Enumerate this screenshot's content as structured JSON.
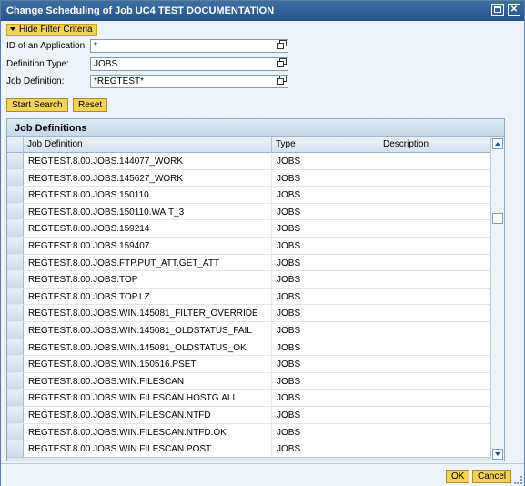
{
  "window": {
    "title": "Change Scheduling of Job UC4 TEST DOCUMENTATION"
  },
  "filter": {
    "toggle_label": "Hide Filter Criteria",
    "fields": [
      {
        "label": "ID of an Application:",
        "value": "*"
      },
      {
        "label": "Definition Type:",
        "value": "JOBS"
      },
      {
        "label": "Job Definition:",
        "value": "*REGTEST*"
      }
    ],
    "start_search_label": "Start Search",
    "reset_label": "Reset"
  },
  "table": {
    "title": "Job Definitions",
    "columns": [
      "Job Definition",
      "Type",
      "Description"
    ],
    "rows": [
      {
        "job": "REGTEST.8.00.JOBS.144077_WORK",
        "type": "JOBS",
        "desc": ""
      },
      {
        "job": "REGTEST.8.00.JOBS.145627_WORK",
        "type": "JOBS",
        "desc": ""
      },
      {
        "job": "REGTEST.8.00.JOBS.150110",
        "type": "JOBS",
        "desc": ""
      },
      {
        "job": "REGTEST.8.00.JOBS.150110.WAIT_3",
        "type": "JOBS",
        "desc": ""
      },
      {
        "job": "REGTEST.8.00.JOBS.159214",
        "type": "JOBS",
        "desc": ""
      },
      {
        "job": "REGTEST.8.00.JOBS.159407",
        "type": "JOBS",
        "desc": ""
      },
      {
        "job": "REGTEST.8.00.JOBS.FTP.PUT_ATT.GET_ATT",
        "type": "JOBS",
        "desc": ""
      },
      {
        "job": "REGTEST.8.00.JOBS.TOP",
        "type": "JOBS",
        "desc": ""
      },
      {
        "job": "REGTEST.8.00.JOBS.TOP.LZ",
        "type": "JOBS",
        "desc": ""
      },
      {
        "job": "REGTEST.8.00.JOBS.WIN.145081_FILTER_OVERRIDE",
        "type": "JOBS",
        "desc": ""
      },
      {
        "job": "REGTEST.8.00.JOBS.WIN.145081_OLDSTATUS_FAIL",
        "type": "JOBS",
        "desc": ""
      },
      {
        "job": "REGTEST.8.00.JOBS.WIN.145081_OLDSTATUS_OK",
        "type": "JOBS",
        "desc": ""
      },
      {
        "job": "REGTEST.8.00.JOBS.WIN.150516.PSET",
        "type": "JOBS",
        "desc": ""
      },
      {
        "job": "REGTEST.8.00.JOBS.WIN.FILESCAN",
        "type": "JOBS",
        "desc": ""
      },
      {
        "job": "REGTEST.8.00.JOBS.WIN.FILESCAN.HOSTG.ALL",
        "type": "JOBS",
        "desc": ""
      },
      {
        "job": "REGTEST.8.00.JOBS.WIN.FILESCAN.NTFD",
        "type": "JOBS",
        "desc": ""
      },
      {
        "job": "REGTEST.8.00.JOBS.WIN.FILESCAN.NTFD.OK",
        "type": "JOBS",
        "desc": ""
      },
      {
        "job": "REGTEST.8.00.JOBS.WIN.FILESCAN.POST",
        "type": "JOBS",
        "desc": ""
      }
    ]
  },
  "footer": {
    "ok_label": "OK",
    "cancel_label": "Cancel"
  },
  "colors": {
    "titlebar": "#2f5f96",
    "button": "#f5d35b",
    "panel_header": "#c8d8ea"
  }
}
